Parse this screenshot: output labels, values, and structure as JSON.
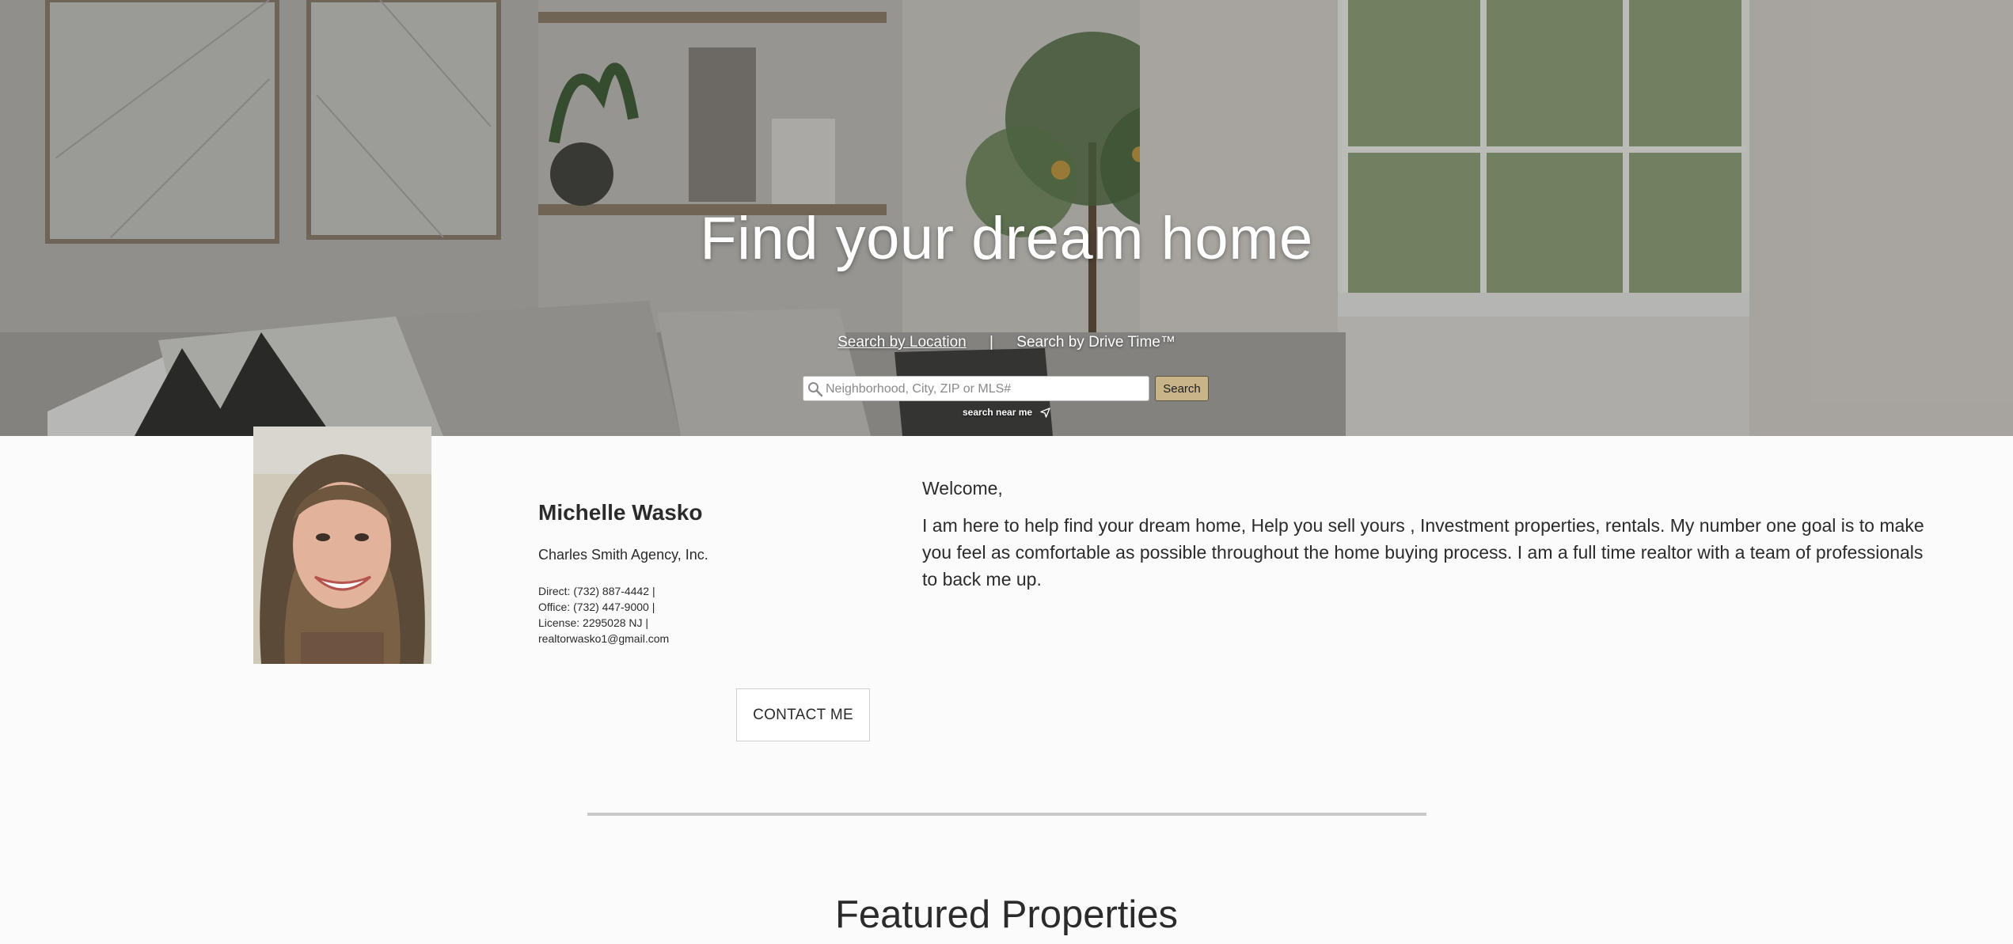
{
  "hero": {
    "title": "Find your dream home",
    "tabs": {
      "location": "Search by Location",
      "separator": "|",
      "drive_time": "Search by Drive Time™"
    },
    "search": {
      "placeholder": "Neighborhood, City, ZIP or MLS#",
      "button": "Search",
      "near_me": "search near me"
    }
  },
  "agent": {
    "name": "Michelle Wasko",
    "agency": "Charles Smith Agency, Inc.",
    "direct": "Direct: (732) 887-4442  |",
    "office": "Office: (732) 447-9000  |",
    "license": "License: 2295028 NJ  |",
    "email": "realtorwasko1@gmail.com",
    "contact_button": "CONTACT ME"
  },
  "welcome": {
    "greeting": "Welcome,",
    "bio": "I am here to help find your dream home, Help you sell yours , Investment properties, rentals. My number one goal is to make you feel as comfortable as possible throughout the home buying process. I am a full time realtor with a team of professionals to back me up."
  },
  "featured": {
    "title": "Featured Properties"
  },
  "colors": {
    "search_button": "#c7b488",
    "page_background": "#fbfbfb",
    "text": "#2b2b2b",
    "divider": "#c9c9c9"
  },
  "icons": {
    "search": "magnifier-icon",
    "near_me": "location-arrow-icon"
  }
}
